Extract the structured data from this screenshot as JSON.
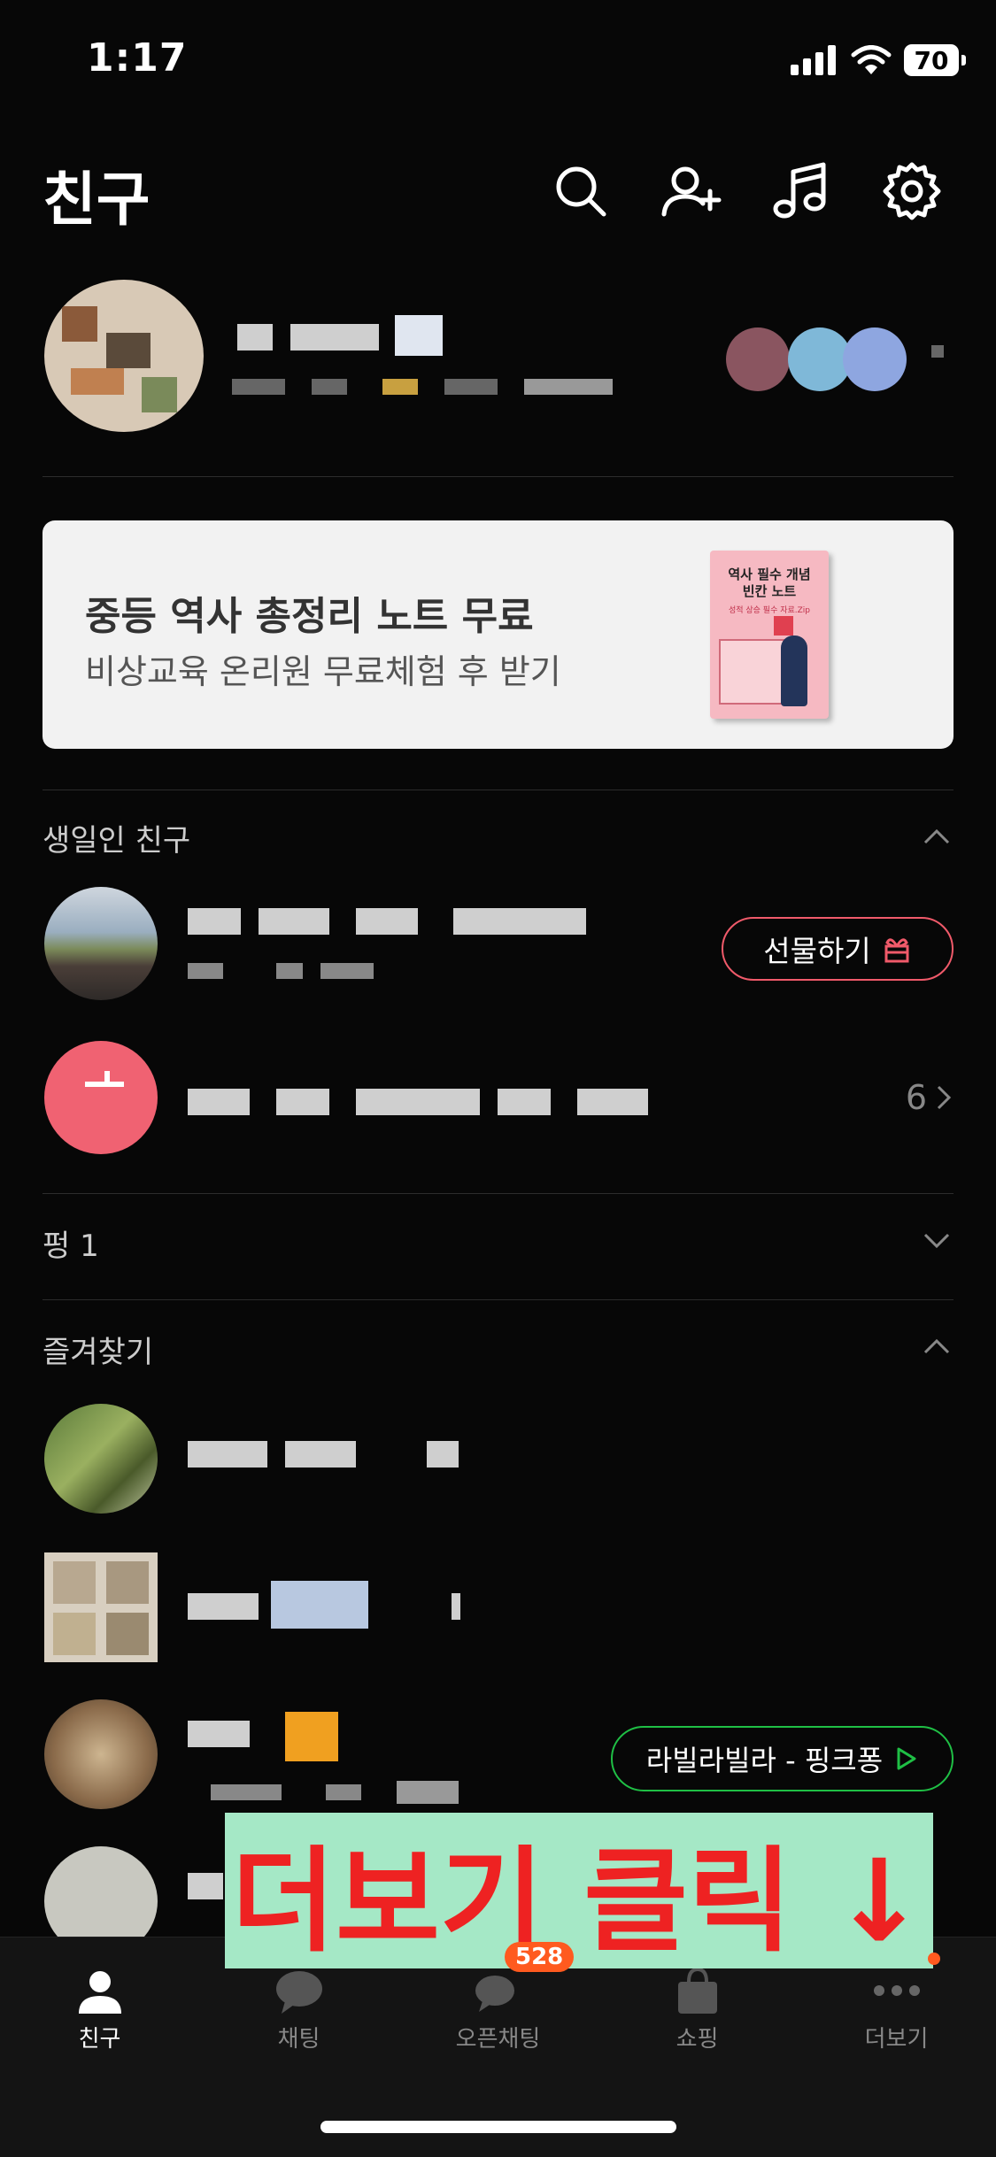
{
  "status_bar": {
    "time": "1:17",
    "battery": "70"
  },
  "header": {
    "title": "친구",
    "icons": [
      "search-icon",
      "add-friend-icon",
      "music-icon",
      "settings-icon"
    ]
  },
  "banner": {
    "title": "중등 역사 총정리 노트 무료",
    "subtitle": "비상교육 온리원 무료체험 후 받기",
    "book_title": "역사 필수 개념\n빈칸 노트",
    "book_subtitle": "성적 상승 필수 자료.Zip"
  },
  "birthday_section": {
    "label": "생일인 친구",
    "gift_button": "선물하기",
    "more_count": "6"
  },
  "pung_section": {
    "label": "펑 1"
  },
  "favorites_section": {
    "label": "즐겨찾기",
    "music_pill": "라빌라빌라 - 핑크퐁"
  },
  "overlay_text": "더보기 클릭 ↓",
  "tabs": [
    {
      "label": "친구",
      "icon": "person-icon",
      "active": true
    },
    {
      "label": "채팅",
      "icon": "chat-icon",
      "active": false
    },
    {
      "label": "오픈채팅",
      "icon": "open-chat-icon",
      "active": false,
      "badge": "528"
    },
    {
      "label": "쇼핑",
      "icon": "shopping-bag-icon",
      "active": false
    },
    {
      "label": "더보기",
      "icon": "more-dots-icon",
      "active": false
    }
  ],
  "colors": {
    "background": "#070707",
    "gift_accent": "#f05a6a",
    "music_accent": "#1fbf45",
    "badge": "#ff5a1f",
    "overlay_bg": "#a5e8c6",
    "overlay_text": "#ee2222"
  }
}
